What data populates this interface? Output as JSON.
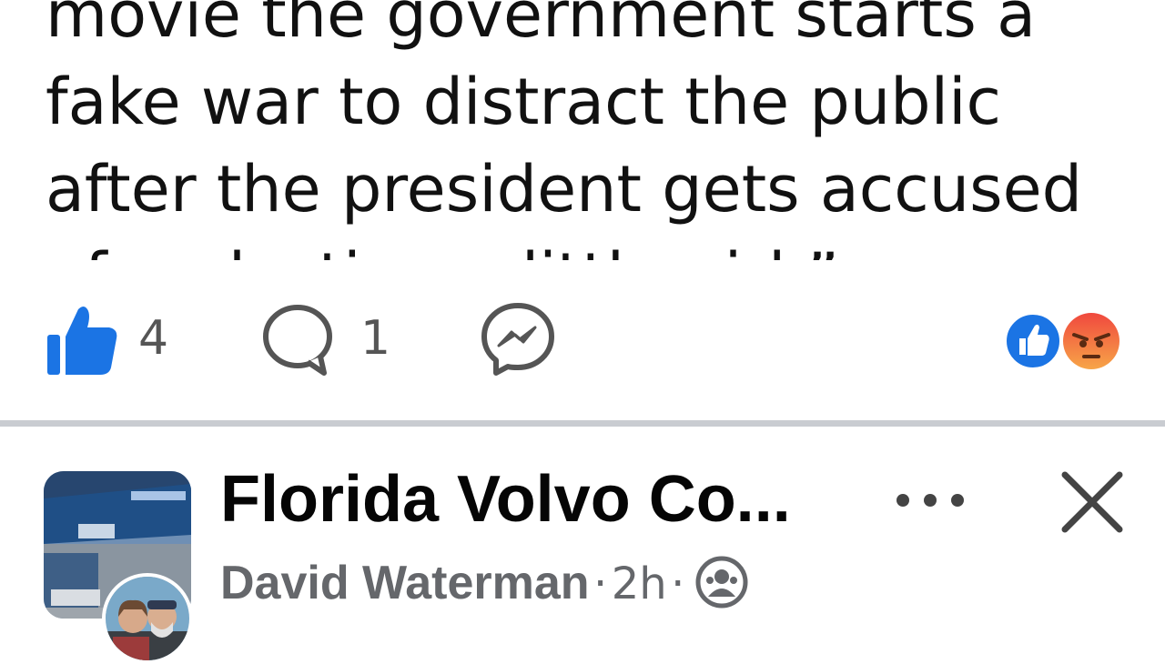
{
  "post": {
    "text_lines": [
      "movie the government starts a",
      "fake war to distract the public",
      "after the president gets accused",
      "of molesting a little girl.”"
    ],
    "like_count": "4",
    "comment_count": "1",
    "icons": {
      "like": "thumbs-up-icon",
      "comment": "comment-bubble-icon",
      "share": "messenger-icon",
      "reactions": [
        "like-reaction-icon",
        "angry-reaction-icon"
      ]
    },
    "colors": {
      "like_blue": "#1b74e4",
      "angry_orange": "#f26a2e",
      "muted_gray": "#65676b"
    }
  },
  "next_post": {
    "page_name": "Florida Volvo Co...",
    "author": "David Waterman",
    "separator": "·",
    "time": "2h",
    "icons": {
      "more": "more-horizontal-icon",
      "close": "close-icon",
      "audience": "friends-audience-icon"
    }
  }
}
